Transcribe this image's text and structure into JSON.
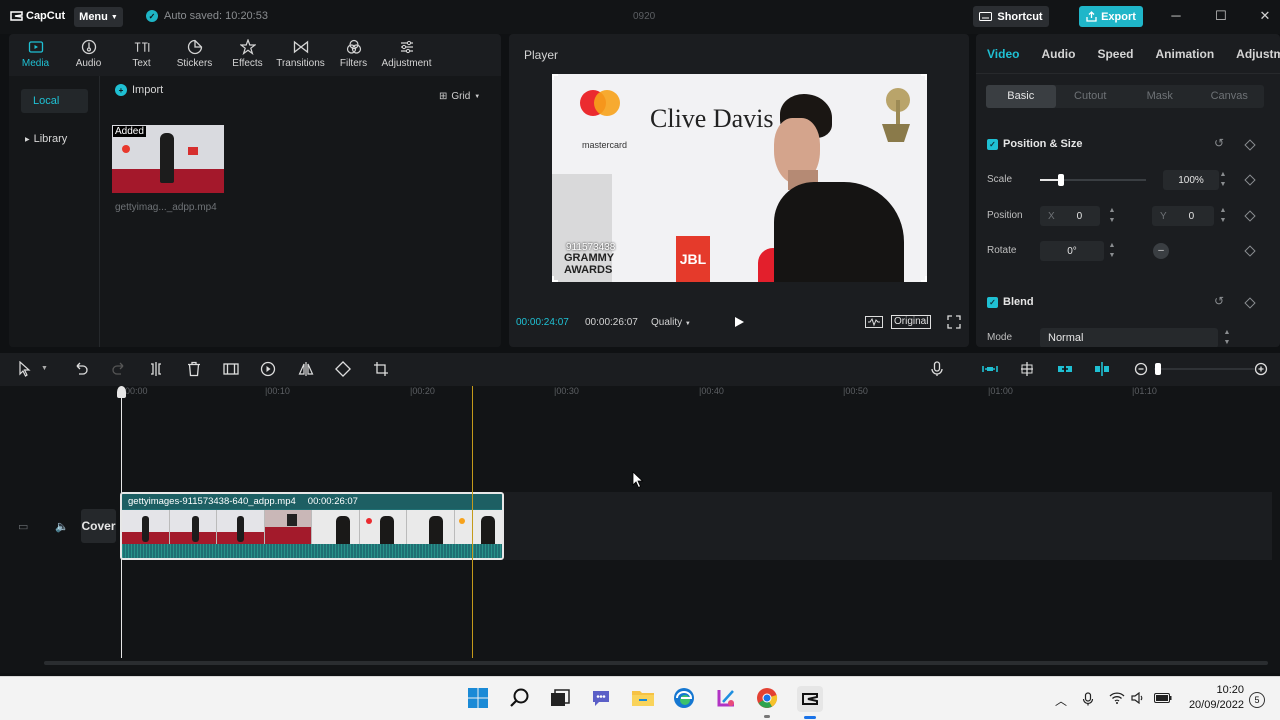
{
  "app": {
    "logo": "CapCut",
    "menu_label": "Menu",
    "autosave": "Auto saved: 10:20:53",
    "project_name": "0920",
    "shortcut_label": "Shortcut",
    "export_label": "Export"
  },
  "media_toolbar": [
    {
      "label": "Media",
      "icon": "media-icon"
    },
    {
      "label": "Audio",
      "icon": "audio-icon"
    },
    {
      "label": "Text",
      "icon": "text-icon"
    },
    {
      "label": "Stickers",
      "icon": "stickers-icon"
    },
    {
      "label": "Effects",
      "icon": "effects-icon"
    },
    {
      "label": "Transitions",
      "icon": "transitions-icon"
    },
    {
      "label": "Filters",
      "icon": "filters-icon"
    },
    {
      "label": "Adjustment",
      "icon": "adjustment-icon"
    }
  ],
  "media": {
    "side_local": "Local",
    "side_library": "Library",
    "import_label": "Import",
    "view_label": "Grid",
    "added_badge": "Added",
    "file_name": "gettyimag..._adpp.mp4"
  },
  "player": {
    "title": "Player",
    "current_time": "00:00:24:07",
    "total_time": "00:00:26:07",
    "quality_label": "Quality",
    "original_label": "Original",
    "overlay_text": "911573438",
    "video_brand_text": "Clive Davis",
    "video_mastercard": "mastercard",
    "video_grammy": "GRAMMY AWARDS",
    "video_jbl": "JBL"
  },
  "properties": {
    "tabs": [
      "Video",
      "Audio",
      "Speed",
      "Animation",
      "Adjustm"
    ],
    "sub_tabs": [
      "Basic",
      "Cutout",
      "Mask",
      "Canvas"
    ],
    "position_size_title": "Position & Size",
    "scale_label": "Scale",
    "scale_value": "100%",
    "scale_fraction": 0.2,
    "position_label": "Position",
    "x_label": "X",
    "x_value": "0",
    "y_label": "Y",
    "y_value": "0",
    "rotate_label": "Rotate",
    "rotate_value": "0°",
    "blend_title": "Blend",
    "mode_label": "Mode",
    "mode_value": "Normal"
  },
  "timeline": {
    "ruler": [
      "00:00",
      "|00:10",
      "|00:20",
      "|00:30",
      "|00:40",
      "|00:50",
      "|01:00",
      "|01:10"
    ],
    "clip_name": "gettyimages-911573438-640_adpp.mp4",
    "clip_duration": "00:00:26:07",
    "cover_label": "Cover"
  },
  "taskbar": {
    "time": "10:20",
    "date": "20/09/2022",
    "notifications": "5"
  },
  "colors": {
    "accent": "#1fc0d3",
    "export": "#1fb6c9",
    "clip": "#1f6f73",
    "playhead_marker": "#c49a1b"
  }
}
